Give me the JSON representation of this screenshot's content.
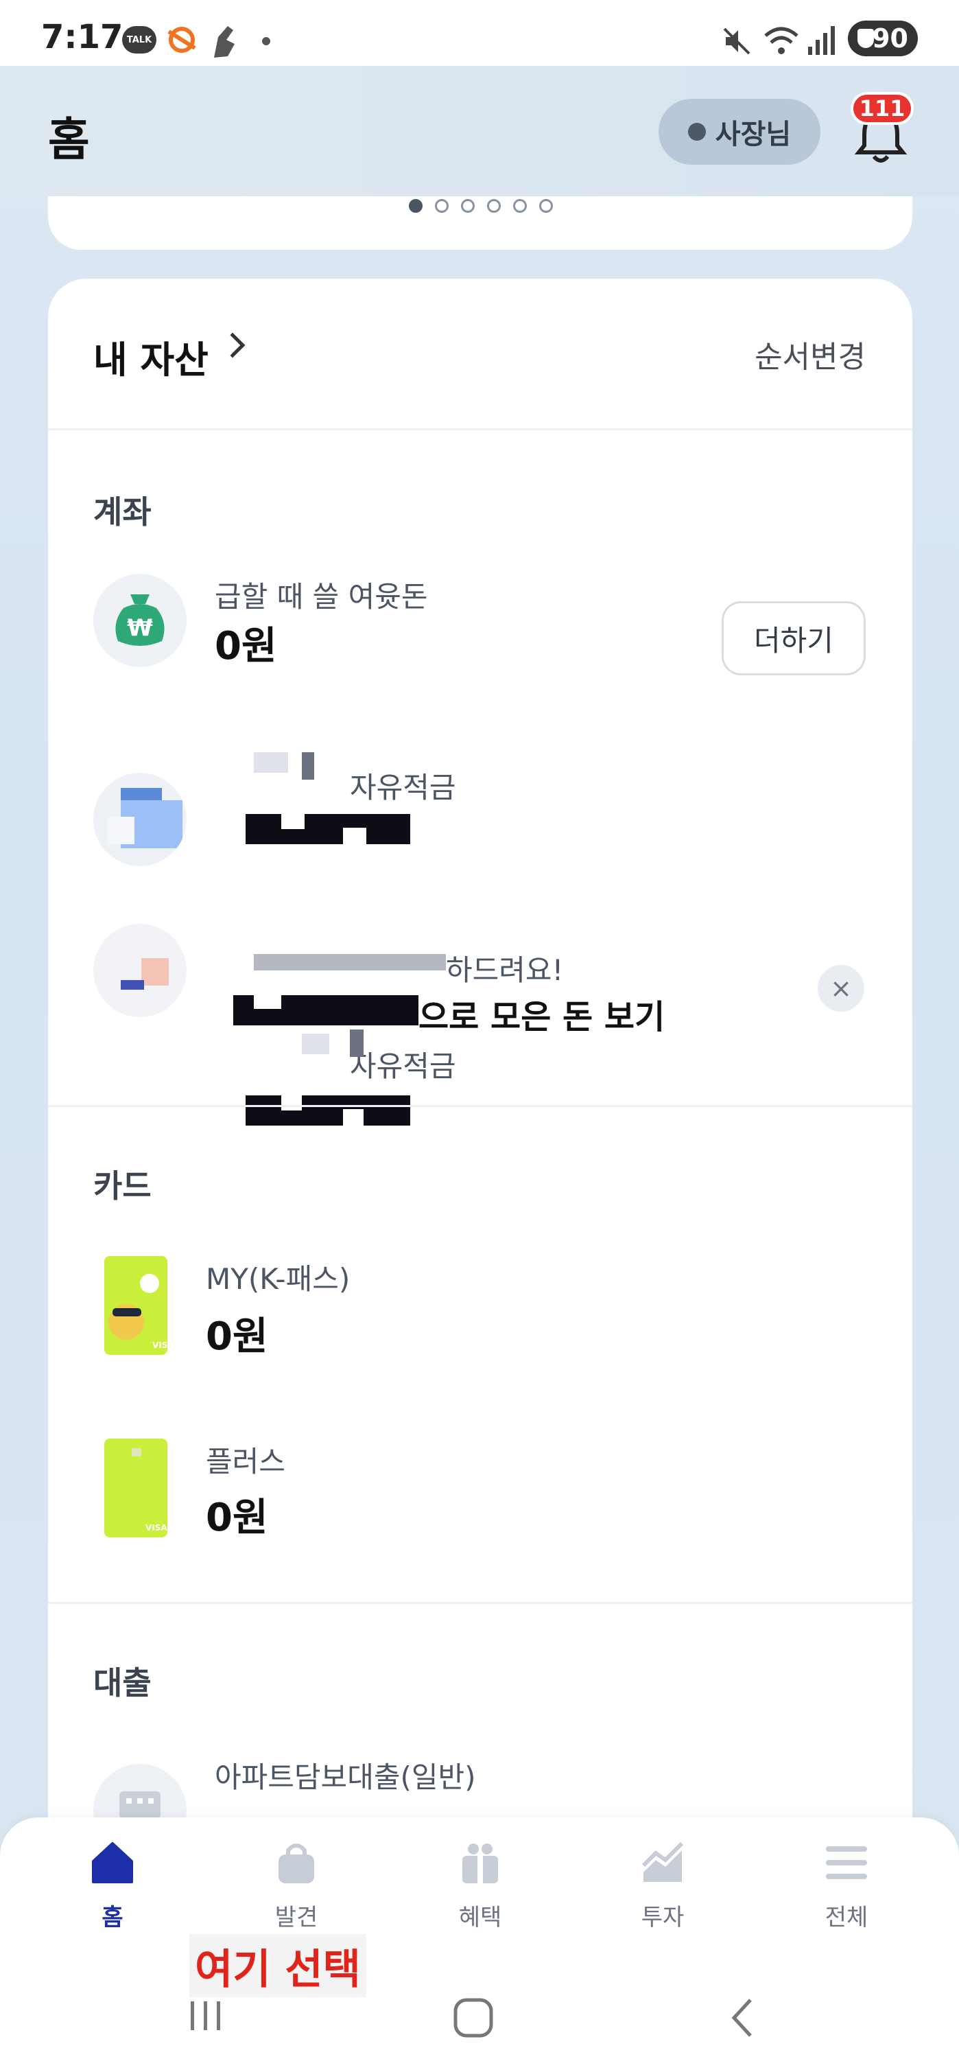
{
  "status_bar": {
    "time": "7:17",
    "talk_badge": "TALK",
    "battery": "90"
  },
  "header": {
    "title": "홈",
    "owner_label": "사장님",
    "notification_count": "111"
  },
  "banner": {
    "page_count": 6,
    "active_page": 1
  },
  "assets": {
    "title": "내 자산",
    "reorder_label": "순서변경",
    "accounts": {
      "section_title": "계좌",
      "items": [
        {
          "label": "급할 때 쓸 여윳돈",
          "amount": "0원",
          "action": "더하기"
        },
        {
          "label": "자유적금",
          "amount": ""
        },
        {
          "label": "하드려요!",
          "amount": "으로 모은 돈 보기"
        }
      ]
    },
    "cards": {
      "section_title": "카드",
      "items": [
        {
          "label": "MY(K-패스)",
          "amount": "0원"
        },
        {
          "label": "플러스",
          "amount": "0원"
        }
      ]
    },
    "loans": {
      "section_title": "대출",
      "items": [
        {
          "label": "아파트담보대출(일반)"
        }
      ]
    }
  },
  "bottom_nav": [
    {
      "label": "홈",
      "icon": "home-icon",
      "active": true
    },
    {
      "label": "발견",
      "icon": "bag-icon",
      "active": false
    },
    {
      "label": "혜택",
      "icon": "gift-icon",
      "active": false
    },
    {
      "label": "투자",
      "icon": "chart-icon",
      "active": false
    },
    {
      "label": "전체",
      "icon": "menu-icon",
      "active": false
    }
  ],
  "annotation": "여기 선택",
  "colors": {
    "accent": "#1c2fa8",
    "badge": "#e8322e",
    "card_lime": "#c9ef3a"
  }
}
